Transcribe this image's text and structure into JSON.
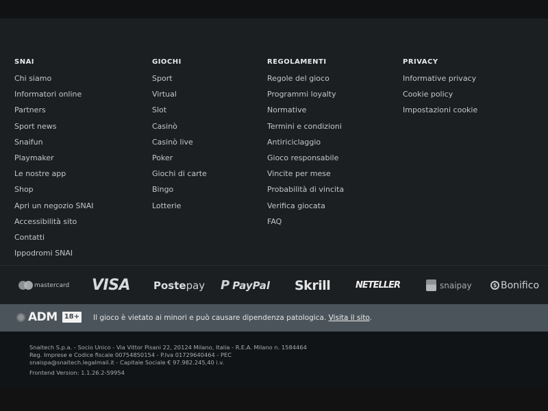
{
  "columns": [
    {
      "title": "SNAI",
      "links": [
        "Chi siamo",
        "Informatori online",
        "Partners",
        "Sport news",
        "Snaifun",
        "Playmaker",
        "Le nostre app",
        "Shop",
        "Apri un negozio SNAI",
        "Accessibilità sito",
        "Contatti",
        "Ippodromi SNAI"
      ]
    },
    {
      "title": "GIOCHI",
      "links": [
        "Sport",
        "Virtual",
        "Slot",
        "Casinò",
        "Casinò live",
        "Poker",
        "Giochi di carte",
        "Bingo",
        "Lotterie"
      ]
    },
    {
      "title": "REGOLAMENTI",
      "links": [
        "Regole del gioco",
        "Programmi loyalty",
        "Normative",
        "Termini e condizioni",
        "Antiriciclaggio",
        "Gioco responsabile",
        "Vincite per mese",
        "Probabilità di vincita",
        "Verifica giocata",
        "FAQ"
      ]
    },
    {
      "title": "PRIVACY",
      "links": [
        "Informative privacy",
        "Cookie policy",
        "Impostazioni cookie"
      ]
    }
  ],
  "payments": [
    {
      "name": "mastercard",
      "icon": "mastercard-logo"
    },
    {
      "name": "VISA",
      "icon": "visa-logo"
    },
    {
      "name_bold": "Poste",
      "name_light": "pay",
      "icon": "postepay-logo"
    },
    {
      "name": "PayPal",
      "icon": "paypal-logo"
    },
    {
      "name": "Skrill",
      "icon": "skrill-logo"
    },
    {
      "name": "NETELLER",
      "icon": "neteller-logo"
    },
    {
      "name": "snaipay",
      "icon": "snaipay-logo"
    },
    {
      "name": "Bonifico",
      "icon": "bonifico-logo"
    }
  ],
  "adm": {
    "logo_text": "ADM",
    "age_badge": "18+",
    "warning": "Il gioco è vietato ai minori e può causare dipendenza patologica.",
    "link": "Visita il sito",
    "link_suffix": "."
  },
  "legal": {
    "line1": "Snaitech S.p.a. - Socio Unico - Via Vittor Pisani 22, 20124 Milano, Italia - R.E.A. Milano n. 1584464",
    "line2": "Reg. Imprese e Codice fiscale 00754850154 - P.Iva 01729640464 - PEC",
    "line3": "snaispa@snaitech.legalmail.it - Capitale Sociale € 97.982.245,40 i.v.",
    "version": "Frontend Version: 1.1.26.2-59954"
  },
  "colors": {
    "footer_bg": "#1b1f22",
    "adm_bar_bg": "#4b545a",
    "legal_bg": "#111417"
  }
}
